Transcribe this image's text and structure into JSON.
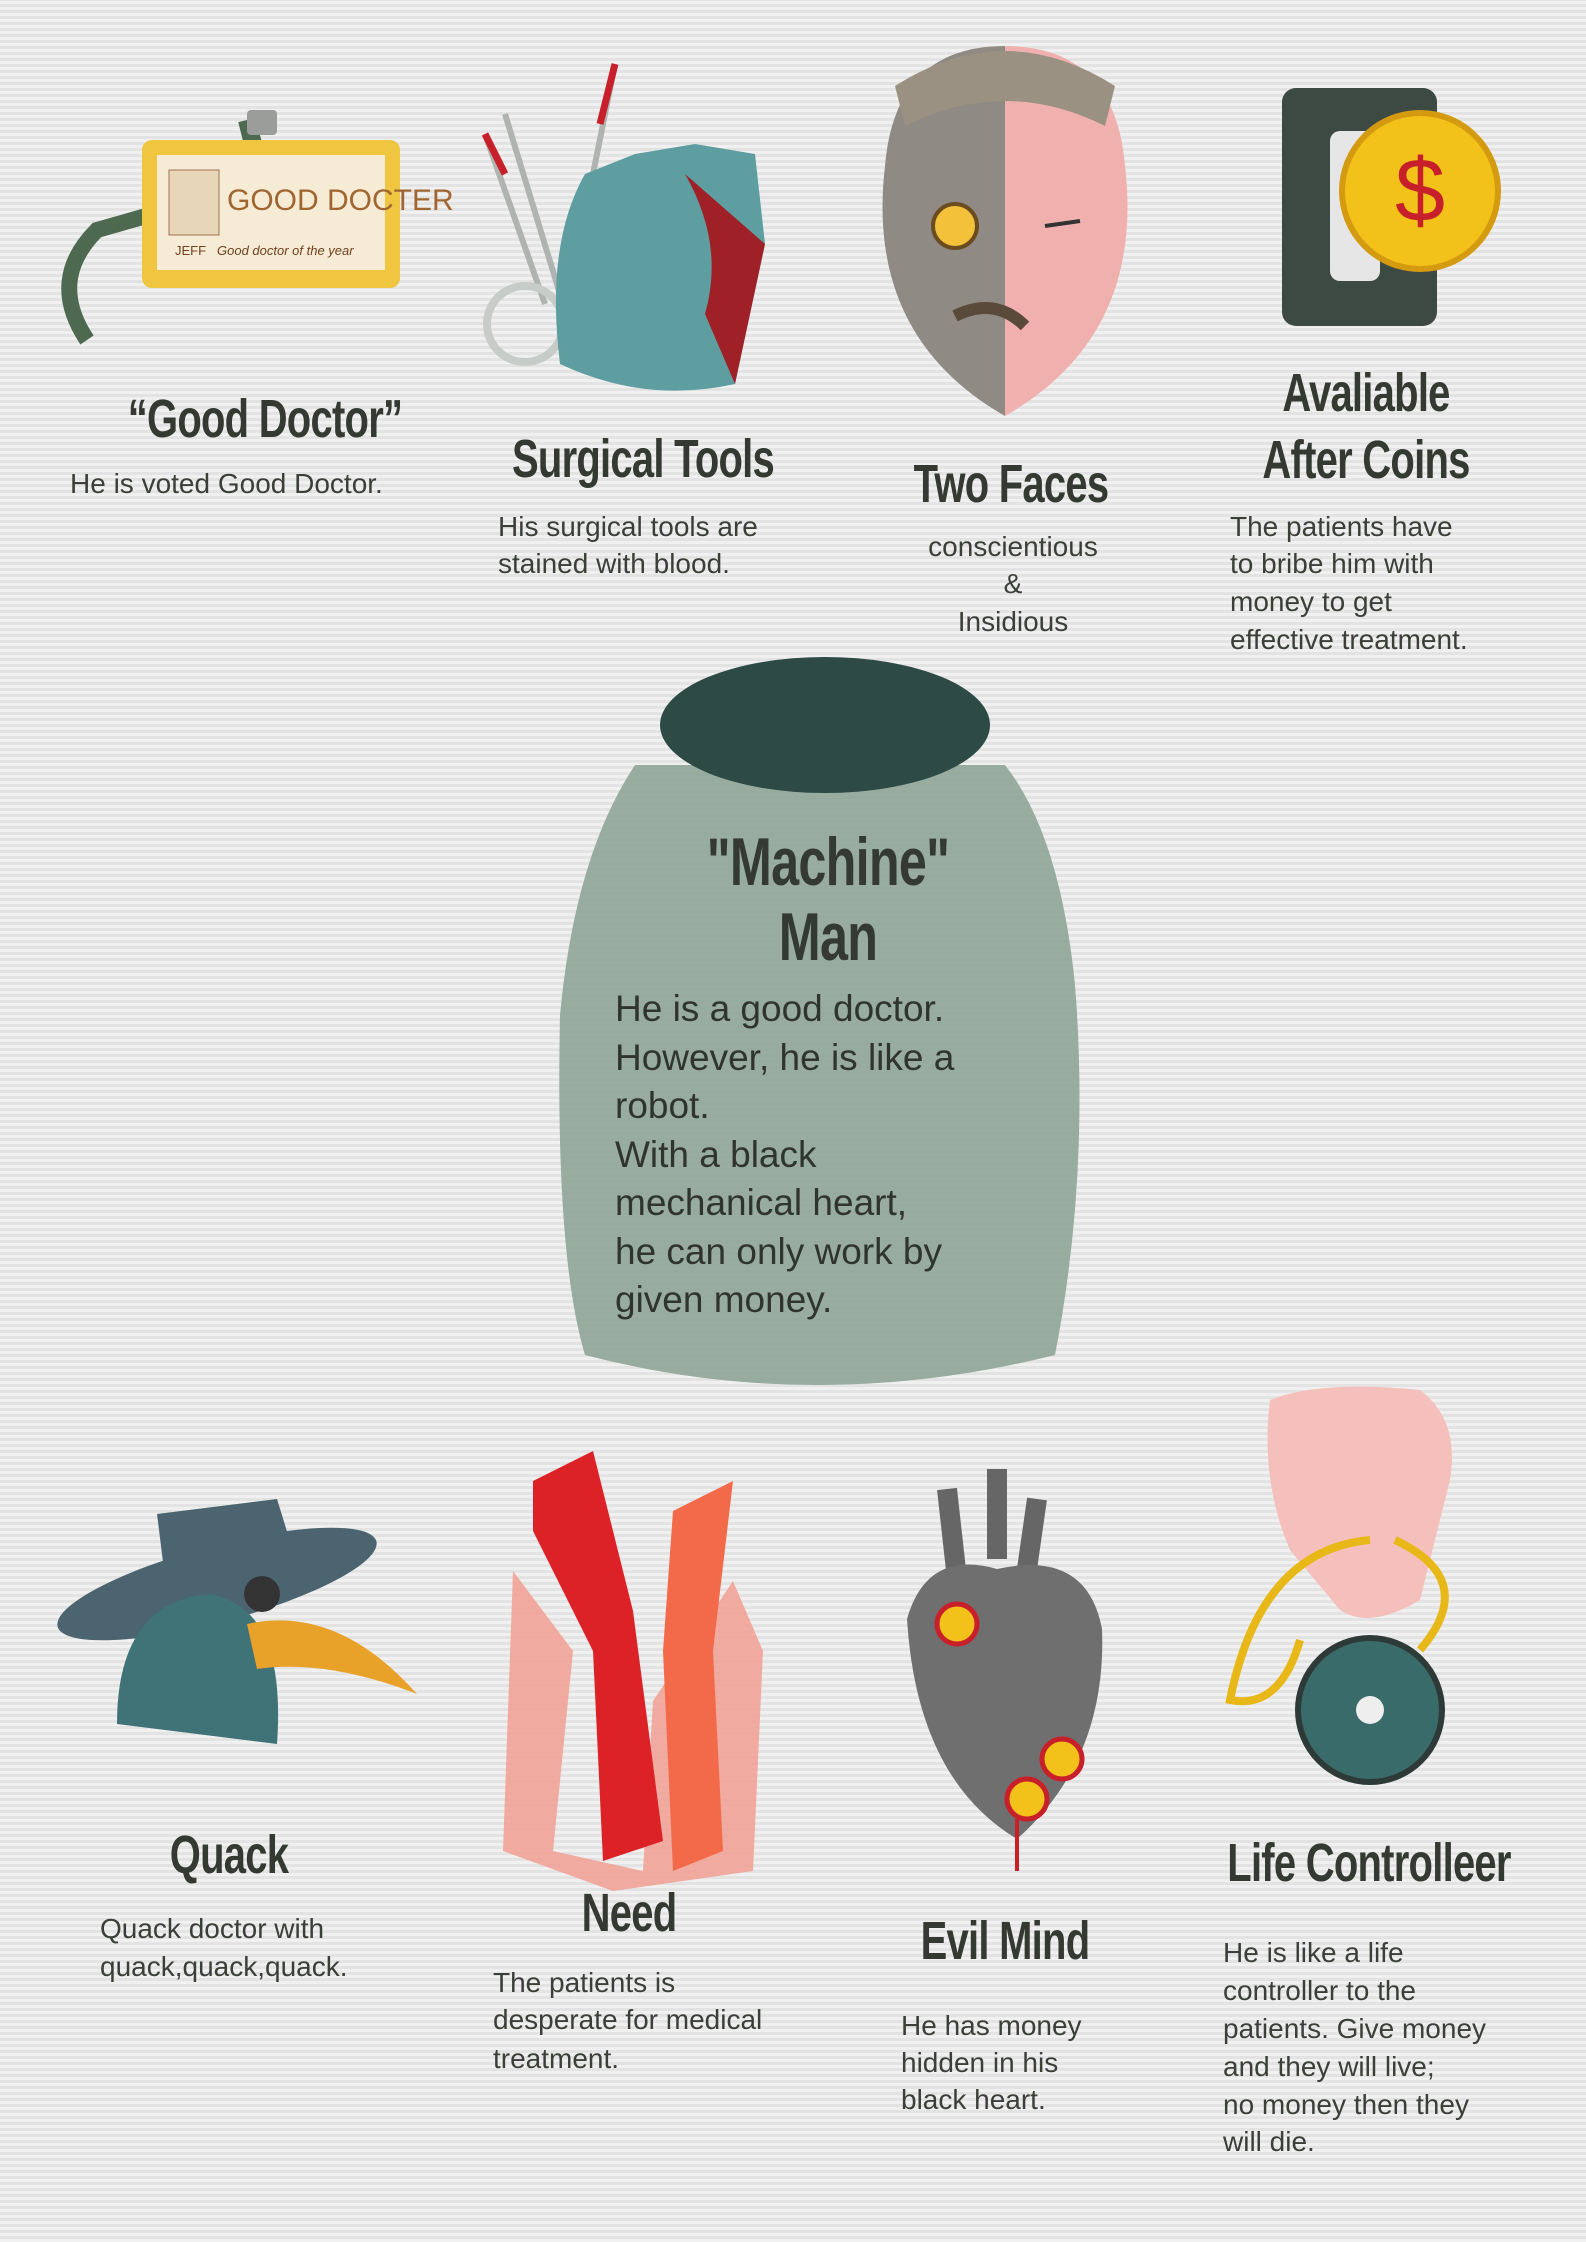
{
  "top": [
    {
      "title": "“Good Doctor”",
      "desc": [
        "He is voted Good Doctor."
      ],
      "badge_text": "GOOD DOCTER",
      "badge_name": "JEFF",
      "badge_sub": "Good doctor of the year"
    },
    {
      "title": "Surgical Tools",
      "desc": [
        "His surgical tools are",
        "stained with blood."
      ]
    },
    {
      "title": "Two Faces",
      "desc": [
        "conscientious",
        "&",
        "Insidious"
      ]
    },
    {
      "title_lines": [
        "Avaliable",
        "After Coins"
      ],
      "desc": [
        "The patients have",
        "to bribe him with",
        "money to get",
        "effective treatment."
      ],
      "coin_symbol": "$"
    }
  ],
  "center": {
    "title_lines": [
      "\"Machine\"",
      "Man"
    ],
    "desc": [
      "He is a good doctor.",
      "However, he is like a",
      "robot.",
      "With a black",
      "mechanical heart,",
      "he can only work by",
      "given money."
    ]
  },
  "bottom": [
    {
      "title": "Quack",
      "desc": [
        "Quack doctor with",
        "quack,quack,quack."
      ]
    },
    {
      "title": "Need",
      "desc": [
        "The patients is",
        "desperate for medical",
        "treatment."
      ]
    },
    {
      "title": "Evil Mind",
      "desc": [
        "He has money",
        "hidden in his",
        "black heart."
      ]
    },
    {
      "title": "Life Controlleer",
      "desc": [
        "He is like a life",
        "controller to the",
        "patients. Give money",
        "and they will live;",
        "no money then they",
        "will die."
      ]
    }
  ],
  "colors": {
    "text": "#343a32",
    "jar": "#8fa596",
    "lid": "#2e4a44",
    "blood": "#c8202a",
    "coin": "#f2c21a"
  }
}
